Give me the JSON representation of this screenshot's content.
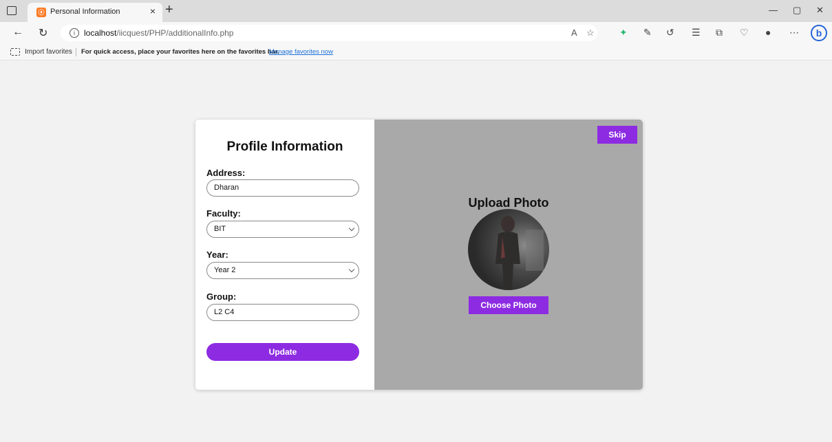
{
  "browser": {
    "tab_title": "Personal Information",
    "url_host": "localhost",
    "url_path": "/iicquest/PHP/additionalInfo.php",
    "favorites_bar": {
      "import_label": "Import favorites",
      "message": "For quick access, place your favorites here on the favorites bar.",
      "manage_link": "Manage favorites now"
    }
  },
  "form": {
    "title": "Profile Information",
    "address": {
      "label": "Address:",
      "value": "Dharan"
    },
    "faculty": {
      "label": "Faculty:",
      "value": "BIT"
    },
    "year": {
      "label": "Year:",
      "value": "Year 2"
    },
    "group": {
      "label": "Group:",
      "value": "L2 C4"
    },
    "update_label": "Update"
  },
  "photo_panel": {
    "skip_label": "Skip",
    "title": "Upload Photo",
    "choose_label": "Choose Photo"
  },
  "colors": {
    "accent": "#8d2be2",
    "photo_panel_bg": "#a9a9a9",
    "page_bg": "#f2f2f2"
  }
}
